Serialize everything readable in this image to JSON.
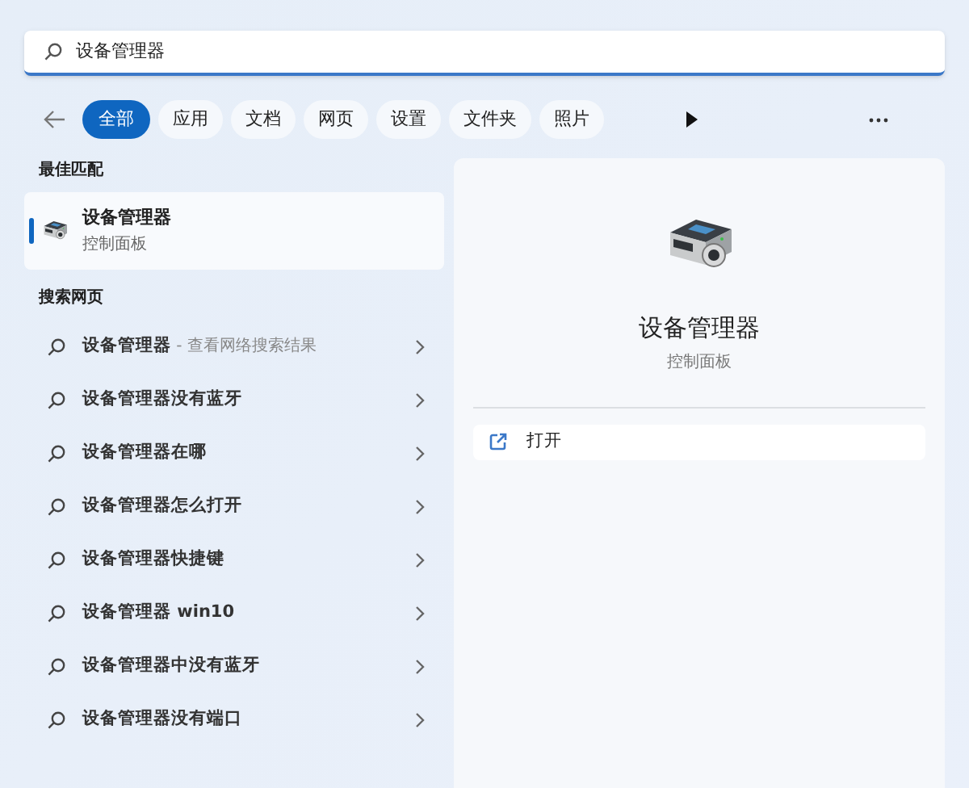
{
  "search": {
    "value": "设备管理器"
  },
  "filters": [
    {
      "label": "全部",
      "selected": true
    },
    {
      "label": "应用",
      "selected": false
    },
    {
      "label": "文档",
      "selected": false
    },
    {
      "label": "网页",
      "selected": false
    },
    {
      "label": "设置",
      "selected": false
    },
    {
      "label": "文件夹",
      "selected": false
    },
    {
      "label": "照片",
      "selected": false
    }
  ],
  "best_match": {
    "heading": "最佳匹配",
    "title": "设备管理器",
    "subtitle": "控制面板",
    "selected": true
  },
  "web": {
    "heading": "搜索网页",
    "items": [
      {
        "text": "设备管理器",
        "suffix": " - 查看网络搜索结果"
      },
      {
        "text": "设备管理器没有蓝牙"
      },
      {
        "text": "设备管理器在哪"
      },
      {
        "text": "设备管理器怎么打开"
      },
      {
        "text": "设备管理器快捷键"
      },
      {
        "text": "设备管理器 win10"
      },
      {
        "text": "设备管理器中没有蓝牙"
      },
      {
        "text": "设备管理器没有端口"
      }
    ]
  },
  "detail": {
    "title": "设备管理器",
    "subtitle": "控制面板",
    "actions": [
      {
        "label": "打开"
      }
    ]
  }
}
